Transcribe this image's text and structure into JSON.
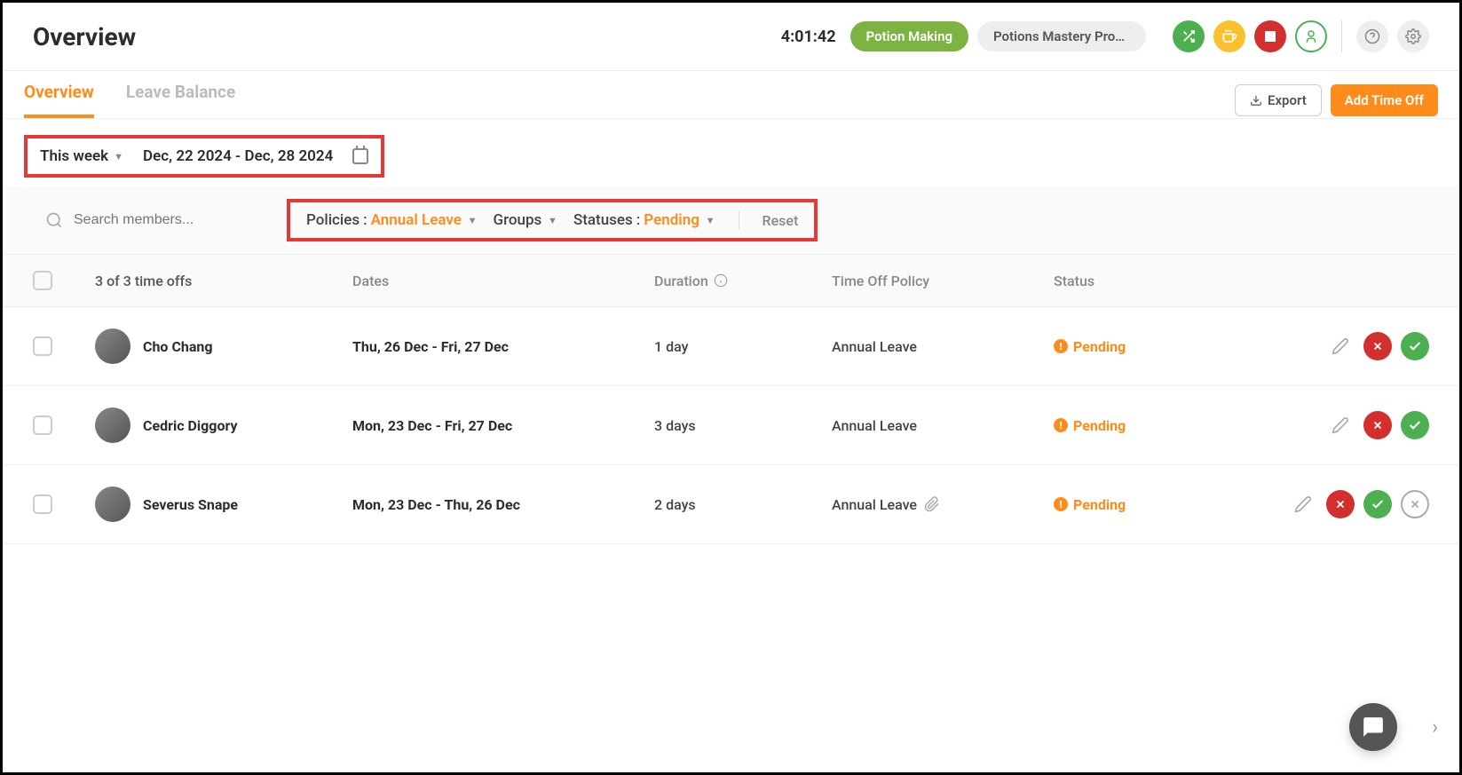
{
  "header": {
    "title": "Overview",
    "timer": "4:01:42",
    "task_pill": "Potion Making",
    "project_pill": "Potions Mastery Progr..."
  },
  "tabs": {
    "overview": "Overview",
    "leave_balance": "Leave Balance",
    "export": "Export",
    "add_time_off": "Add Time Off"
  },
  "date_filter": {
    "period_label": "This week",
    "range": "Dec, 22 2024 - Dec, 28 2024"
  },
  "search": {
    "placeholder": "Search members..."
  },
  "filters": {
    "policies_label": "Policies",
    "policies_value": "Annual Leave",
    "groups_label": "Groups",
    "statuses_label": "Statuses",
    "statuses_value": "Pending",
    "reset": "Reset"
  },
  "table": {
    "count_text": "3 of 3 time offs",
    "headers": {
      "dates": "Dates",
      "duration": "Duration",
      "policy": "Time Off Policy",
      "status": "Status"
    },
    "rows": [
      {
        "name": "Cho Chang",
        "dates": "Thu, 26 Dec - Fri, 27 Dec",
        "duration": "1 day",
        "policy": "Annual Leave",
        "status": "Pending",
        "has_attachment": false,
        "has_cancel": false
      },
      {
        "name": "Cedric Diggory",
        "dates": "Mon, 23 Dec - Fri, 27 Dec",
        "duration": "3 days",
        "policy": "Annual Leave",
        "status": "Pending",
        "has_attachment": false,
        "has_cancel": false
      },
      {
        "name": "Severus Snape",
        "dates": "Mon, 23 Dec - Thu, 26 Dec",
        "duration": "2 days",
        "policy": "Annual Leave",
        "status": "Pending",
        "has_attachment": true,
        "has_cancel": true
      }
    ]
  }
}
